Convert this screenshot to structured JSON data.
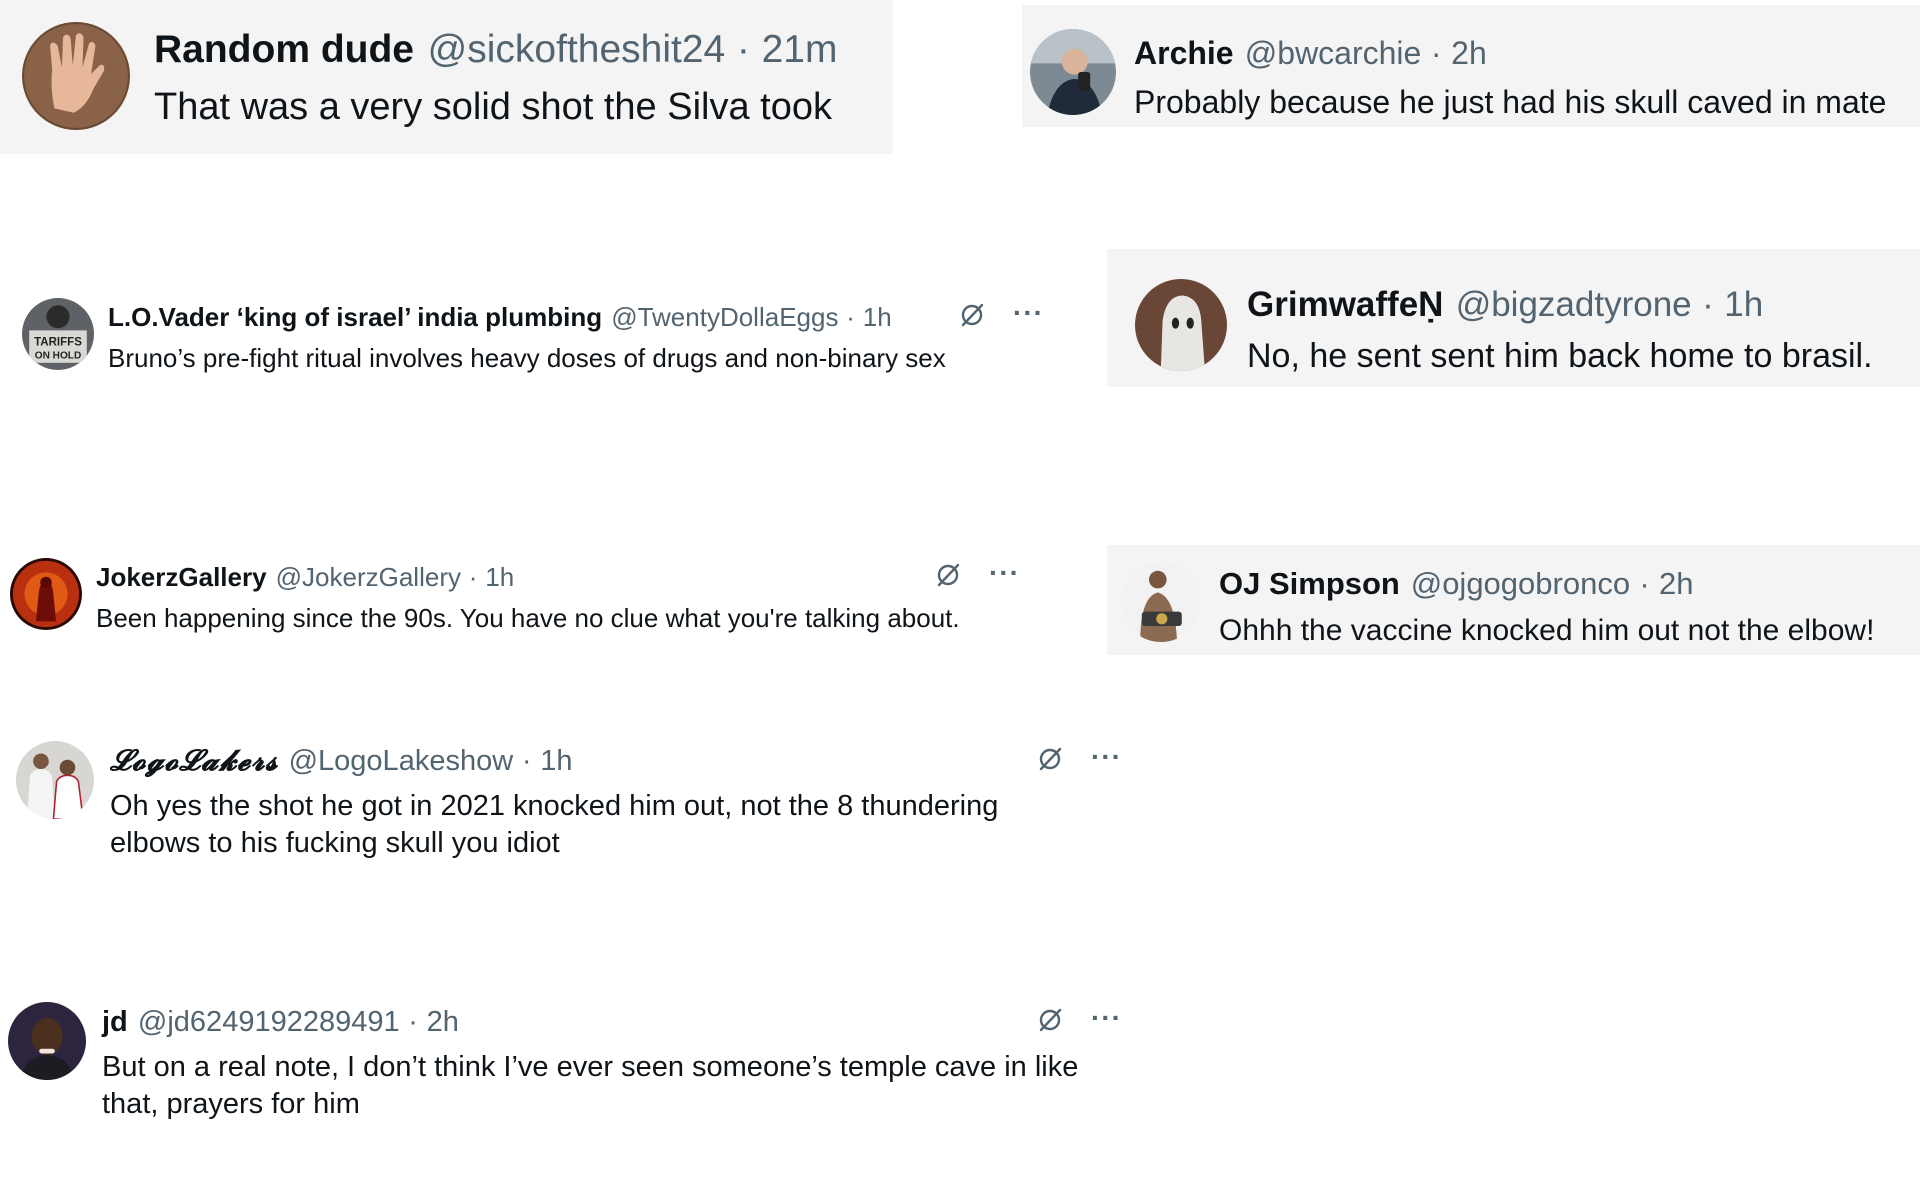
{
  "tweets": [
    {
      "name": "Random dude",
      "handle": "@sickoftheshit24",
      "sep": "·",
      "time": "21m",
      "text": "That was a very solid shot the Silva took",
      "avatar": "raised-hand-avatar"
    },
    {
      "name": "Archie",
      "handle": "@bwcarchie",
      "sep": "·",
      "time": "2h",
      "text": "Probably because he just had his skull caved in mate",
      "avatar": "selfie-avatar"
    },
    {
      "name": "L.O.Vader ‘king of israel’ india plumbing",
      "handle": "@TwentyDollaEggs",
      "sep": "·",
      "time": "1h",
      "text": "Bruno’s pre-fight ritual involves heavy doses of drugs and non-binary sex",
      "avatar": "tariffs-sign-avatar"
    },
    {
      "name": "GrimwaffeṆ",
      "handle": "@bigzadtyrone",
      "sep": "·",
      "time": "1h",
      "text": "No, he sent sent him back home to brasil.",
      "avatar": "ghost-avatar"
    },
    {
      "name": "JokerzGallery",
      "handle": "@JokerzGallery",
      "sep": "·",
      "time": "1h",
      "text": "Been happening since the 90s. You have no clue what you're talking about.",
      "avatar": "red-figure-avatar"
    },
    {
      "name": "OJ Simpson",
      "handle": "@ojgogobronco",
      "sep": "·",
      "time": "2h",
      "text": "Ohhh the vaccine knocked him out not the elbow!",
      "avatar": "fighter-belt-avatar"
    },
    {
      "name": "𝓛𝓸𝓰𝓸𝓛𝓪𝓴𝓮𝓻𝓼",
      "handle": "@LogoLakeshow",
      "sep": "·",
      "time": "1h",
      "text_line1": "Oh yes the shot he got in 2021 knocked him out, not the 8 thundering",
      "text_line2": "elbows to his fucking skull you idiot",
      "avatar": "basketball-players-avatar"
    },
    {
      "name": "jd",
      "handle": "@jd6249192289491",
      "sep": "·",
      "time": "2h",
      "text_line1": "But on a real note, I don’t think I’ve ever seen someone’s temple cave in like",
      "text_line2": "that, prayers for him",
      "avatar": "portrait-avatar"
    }
  ],
  "actions": {
    "more": "···"
  },
  "colors": {
    "name": "#0f1419",
    "meta": "#536471",
    "card_grey": "#f4f4f5"
  }
}
